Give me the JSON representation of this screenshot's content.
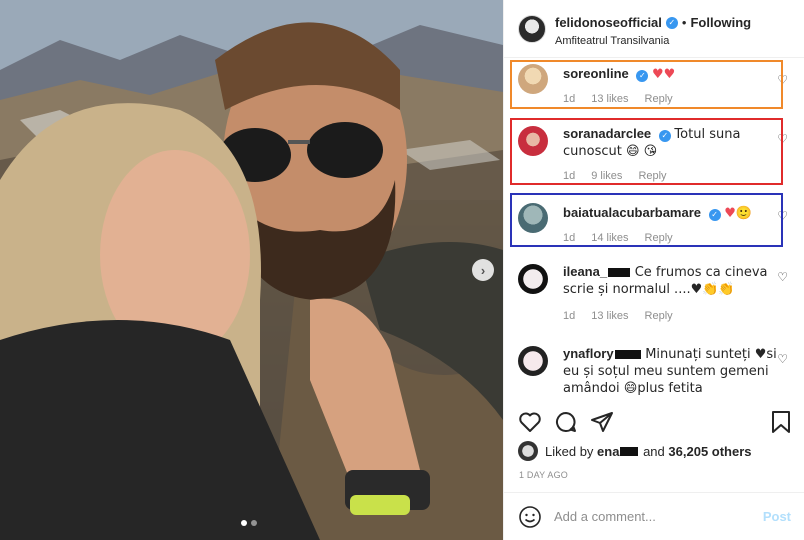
{
  "post": {
    "username": "felidonoseofficial",
    "separator": "•",
    "follow_label": "Following",
    "location": "Amfiteatrul Transilvania"
  },
  "comments": [
    {
      "user": "soreonline",
      "text": "♥♥",
      "age": "1d",
      "likes": "13 likes",
      "reply": "Reply",
      "box_color": "#f0892a"
    },
    {
      "user": "soranadarclee",
      "text": "Totul suna cunoscut 😄 😘",
      "age": "1d",
      "likes": "9 likes",
      "reply": "Reply",
      "box_color": "#e02b2b"
    },
    {
      "user": "baiatualacubarbamare",
      "text": "♥🙂",
      "age": "1d",
      "likes": "14 likes",
      "reply": "Reply",
      "box_color": "#2a33b8"
    },
    {
      "user": "ileana_",
      "text": "Ce frumos ca cineva scrie și normalul ....♥👏👏",
      "age": "1d",
      "likes": "13 likes",
      "reply": "Reply"
    },
    {
      "user": "ynaflory",
      "text": "Minunați sunteți ♥si eu și soțul meu suntem gemeni amândoi 😄plus fetita",
      "age": "",
      "likes": "",
      "reply": ""
    }
  ],
  "likes_bar": {
    "prefix": "Liked by",
    "user": "ena",
    "middle": "and",
    "count": "36,205 others"
  },
  "date": "1 DAY AGO",
  "composer": {
    "placeholder": "Add a comment...",
    "post_label": "Post"
  },
  "icons": {
    "carousel_next": "›",
    "verified": "✓"
  }
}
